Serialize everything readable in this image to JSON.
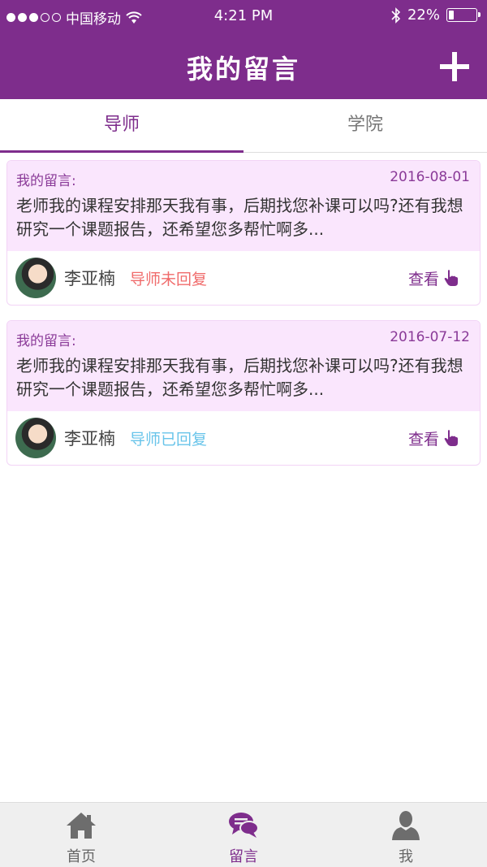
{
  "status": {
    "carrier": "中国移动",
    "time": "4:21 PM",
    "battery": "22%"
  },
  "header": {
    "title": "我的留言"
  },
  "tabs": [
    {
      "label": "导师"
    },
    {
      "label": "学院"
    }
  ],
  "messages": [
    {
      "heading": "我的留言:",
      "date": "2016-08-01",
      "text": "老师我的课程安排那天我有事，后期找您补课可以吗?还有我想研究一个课题报告，还希望您多帮忙啊多...",
      "name": "李亚楠",
      "status": "导师未回复",
      "view": "查看"
    },
    {
      "heading": "我的留言:",
      "date": "2016-07-12",
      "text": "老师我的课程安排那天我有事，后期找您补课可以吗?还有我想研究一个课题报告，还希望您多帮忙啊多...",
      "name": "李亚楠",
      "status": "导师已回复",
      "view": "查看"
    }
  ],
  "nav": [
    {
      "label": "首页",
      "icon": "home-icon"
    },
    {
      "label": "留言",
      "icon": "chat-icon"
    },
    {
      "label": "我",
      "icon": "user-icon"
    }
  ],
  "colors": {
    "brand": "#7e2d8c",
    "pending": "#f06b6b",
    "replied": "#68c4ea",
    "card_tint": "#fae6fd"
  }
}
